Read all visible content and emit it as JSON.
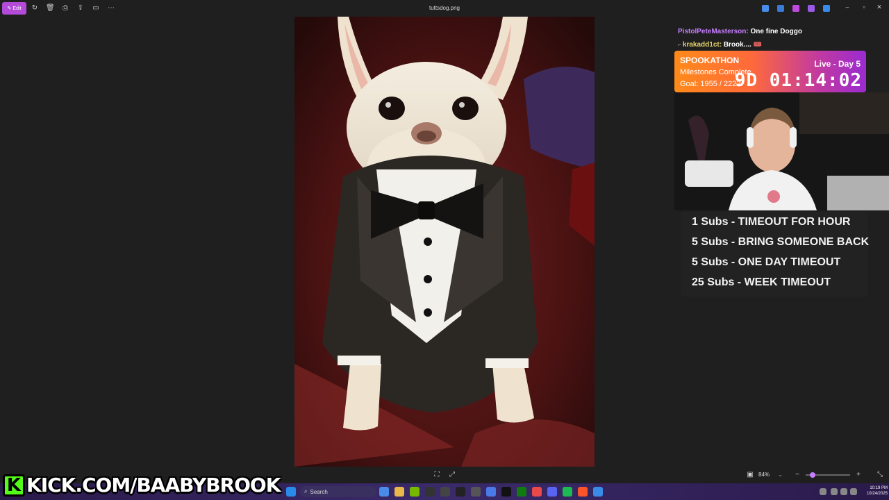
{
  "toolbar": {
    "edit_label": "Edit",
    "filename": "tuttsdog.png"
  },
  "chat": [
    {
      "user": "PistolPeteMasterson:",
      "message": "One fine Doggo"
    },
    {
      "user": "krakadd1ct:",
      "message": "Brook.... 🎟️"
    }
  ],
  "banner": {
    "title": "SPOOKATHON",
    "milestones": "Milestones Complete",
    "goal": "Goal: 1955 / 2222",
    "live": "Live - Day 5",
    "timer": "9D 01:14:02"
  },
  "subs": [
    "1 Subs - TIMEOUT FOR HOUR",
    "5 Subs - BRING SOMEONE BACK",
    "5 Subs - ONE DAY TIMEOUT",
    "25 Subs - WEEK TIMEOUT"
  ],
  "viewer": {
    "zoom": "84%"
  },
  "taskbar": {
    "search_placeholder": "Search",
    "time": "10:19 PM",
    "date": "10/24/2025"
  },
  "overlay": {
    "kick_letter": "K",
    "kick_url": "KICK.COM/BAABYBROOK"
  },
  "colors": {
    "accent": "#b34bd8",
    "kick_green": "#53fc18",
    "chat_user1": "#c77dff",
    "chat_user2": "#e8d36a"
  }
}
